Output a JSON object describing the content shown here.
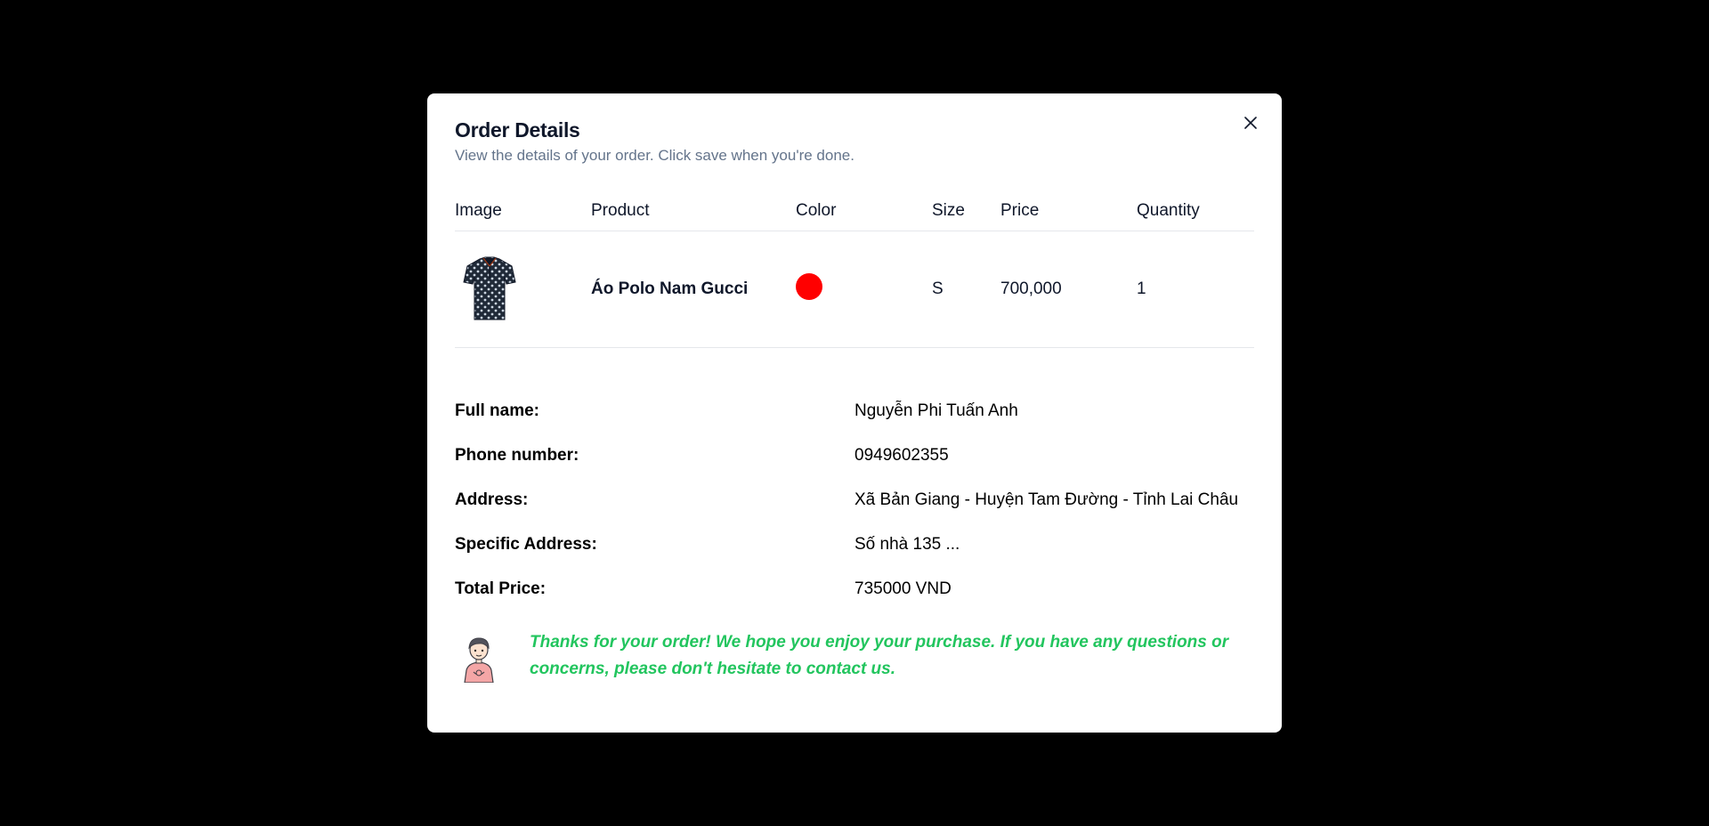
{
  "dialog": {
    "title": "Order Details",
    "subtitle": "View the details of your order. Click save when you're done.",
    "close_icon": "close-icon"
  },
  "table": {
    "headers": [
      "Image",
      "Product",
      "Color",
      "Size",
      "Price",
      "Quantity"
    ],
    "rows": [
      {
        "image_icon": "polo-shirt-image",
        "product": "Áo Polo Nam Gucci",
        "color": "#ff0000",
        "size": "S",
        "price": "700,000",
        "quantity": "1"
      }
    ]
  },
  "info": {
    "full_name_label": "Full name:",
    "full_name": "Nguyễn Phi Tuấn Anh",
    "phone_label": "Phone number:",
    "phone": "0949602355",
    "address_label": "Address:",
    "address": "Xã Bản Giang - Huyện Tam Đường - Tỉnh Lai Châu",
    "specific_address_label": "Specific Address:",
    "specific_address": "Số nhà 135 ...",
    "total_label": "Total Price:",
    "total": "735000 VND"
  },
  "thanks": {
    "avatar_icon": "person-avatar-icon",
    "message": "Thanks for your order! We hope you enjoy your purchase. If you have any questions or concerns, please don't hesitate to contact us."
  },
  "colors": {
    "accent_green": "#22c55e",
    "overlay": "#000000",
    "muted_text": "#64748b"
  }
}
